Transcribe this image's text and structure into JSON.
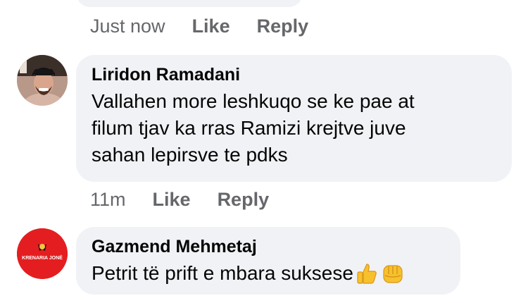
{
  "comments": [
    {
      "time": "Just now",
      "like_label": "Like",
      "reply_label": "Reply"
    },
    {
      "author": "Liridon Ramadani",
      "lines": [
        "Vallahen more leshkuqo se ke pae at",
        "filum tjav ka rras Ramizi krejtve juve",
        "sahan lepirsve te pdks"
      ],
      "time": "11m",
      "like_label": "Like",
      "reply_label": "Reply"
    },
    {
      "author": "Gazmend Mehmetaj",
      "text": "Petrit të prift e mbara suksese",
      "avatar_label": "KRENARIA JONË"
    }
  ],
  "colors": {
    "bubble": "#f0f2f5",
    "meta_text": "#65676b",
    "avatar_red": "#e41e20"
  },
  "icons": [
    "thumbs-up-emoji",
    "raised-fist-emoji"
  ]
}
